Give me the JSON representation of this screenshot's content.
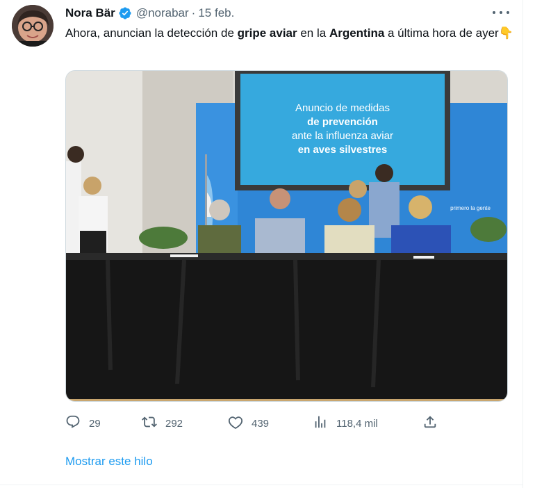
{
  "tweet": {
    "author_name": "Nora Bär",
    "handle": "@norabar",
    "separator": "·",
    "date": "15 feb.",
    "text_parts": [
      "Ahora, anuncian la detección de ",
      "gripe aviar",
      " en la ",
      "Argentina",
      " a última hora de ayer",
      "👇"
    ],
    "image": {
      "screen_lines": [
        "Anuncio de medidas",
        "de prevención",
        "ante la influenza aviar",
        "en aves silvestres"
      ],
      "banner_text": "primero la gente"
    },
    "metrics": {
      "replies": "29",
      "retweets": "292",
      "likes": "439",
      "views": "118,4 mil"
    },
    "show_thread": "Mostrar este hilo"
  },
  "icons": {
    "verified": "verified-badge-icon",
    "more": "more-options-icon",
    "reply": "reply-icon",
    "retweet": "retweet-icon",
    "like": "like-icon",
    "views": "views-icon",
    "share": "share-icon"
  },
  "colors": {
    "accent": "#1d9bf0",
    "text": "#0f1419",
    "muted": "#536471"
  }
}
